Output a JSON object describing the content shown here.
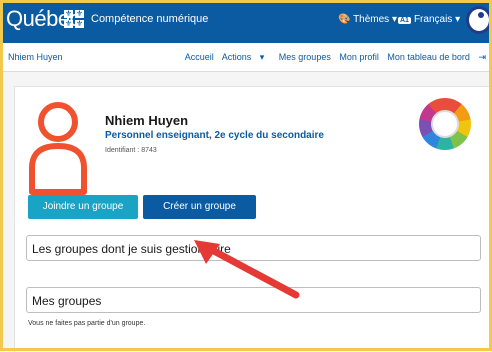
{
  "header": {
    "brand": "Québec",
    "app_title": "Compétence numérique",
    "themes_label": "Thèmes",
    "language_label": "Français",
    "language_badge": "A1"
  },
  "subnav": {
    "user_name": "Nhiem Huyen",
    "links": [
      "Accueil",
      "Actions",
      "Mes groupes",
      "Mon profil",
      "Mon tableau de bord"
    ]
  },
  "profile": {
    "name": "Nhiem Huyen",
    "role": "Personnel enseignant, 2e cycle du secondaire",
    "identifier": "Identifiant : 8743"
  },
  "buttons": {
    "join": "Joindre un groupe",
    "create": "Créer un groupe"
  },
  "sections": {
    "managed_groups": "Les groupes dont je suis gestionnaire",
    "my_groups": "Mes groupes",
    "my_groups_note": "Vous ne faites pas partie d'un groupe."
  },
  "colors": {
    "header_bg": "#0b5ba3",
    "join_button": "#19a3c4",
    "create_button": "#0b5ba3",
    "avatar": "#f0512e",
    "annotation_arrow": "#e53935"
  }
}
